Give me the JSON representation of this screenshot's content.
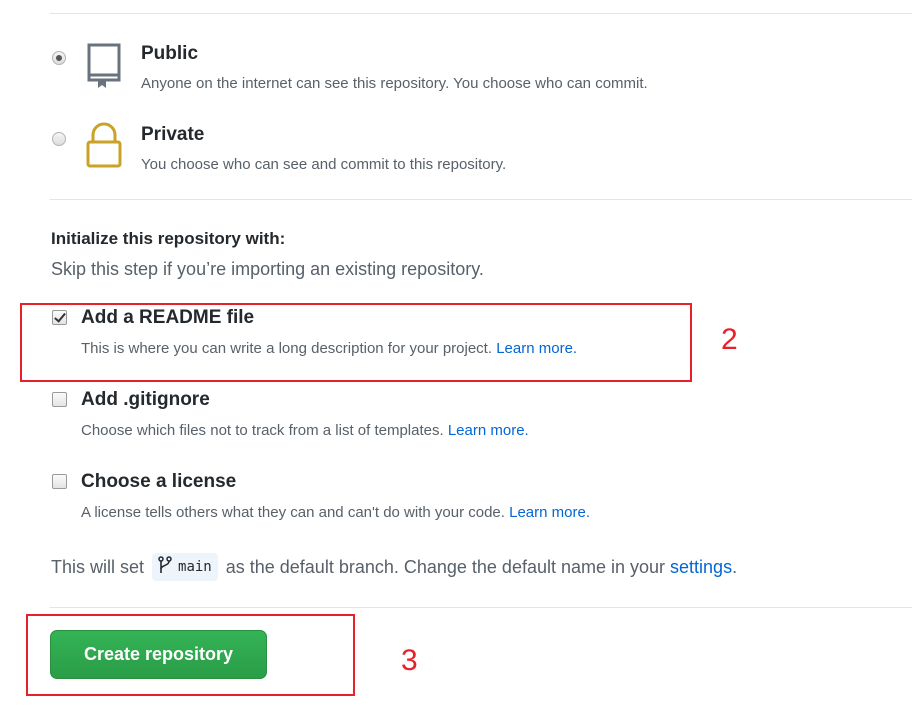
{
  "visibility": {
    "public": {
      "title": "Public",
      "description": "Anyone on the internet can see this repository. You choose who can commit.",
      "selected": true,
      "icon": "repo-icon"
    },
    "private": {
      "title": "Private",
      "description": "You choose who can see and commit to this repository.",
      "selected": false,
      "icon": "lock-icon"
    }
  },
  "initialize": {
    "title": "Initialize this repository with:",
    "subtitle": "Skip this step if you’re importing an existing repository.",
    "readme": {
      "title": "Add a README file",
      "description": "This is where you can write a long description for your project.",
      "link": "Learn more.",
      "checked": true
    },
    "gitignore": {
      "title": "Add .gitignore",
      "description": "Choose which files not to track from a list of templates.",
      "link": "Learn more.",
      "checked": false
    },
    "license": {
      "title": "Choose a license",
      "description": "A license tells others what they can and can't do with your code.",
      "link": "Learn more.",
      "checked": false
    }
  },
  "branch": {
    "prefix": "This will set",
    "name": "main",
    "suffix": "as the default branch. Change the default name in your",
    "settings_link": "settings",
    "period": "."
  },
  "create_button": {
    "label": "Create repository"
  },
  "annotations": {
    "step2": "2",
    "step3": "3",
    "color": "#e8202a"
  },
  "colors": {
    "button_green": "#2ea44f",
    "link_blue": "#0366d6",
    "lock_gold": "#c9a227"
  }
}
